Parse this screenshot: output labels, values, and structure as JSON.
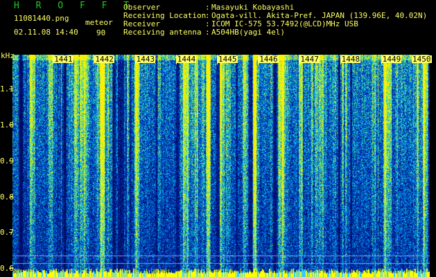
{
  "header": {
    "title": "H R O F F T",
    "file_name": "11081440.png",
    "date_time": "02.11.08 14:40",
    "mode_label": "meteor",
    "mode_value": "90",
    "fields": [
      {
        "key": "Observer",
        "value": "Masayuki Kobayashi"
      },
      {
        "key": "Receiving Location",
        "value": "Ogata-vill. Akita-Pref. JAPAN (139.96E, 40.02N)"
      },
      {
        "key": "Receiver",
        "value": "ICOM IC-575 53.7492(@LCD)MHz USB"
      },
      {
        "key": "Receiving antenna",
        "value": "A504HB(yagi 4el)"
      }
    ],
    "separator": ":"
  },
  "colors": {
    "background": "#000000",
    "text": "#ffff66",
    "title": "#22cc22",
    "spectrum_low": "#001a66",
    "spectrum_high": "#ffff00"
  },
  "chart_data": {
    "type": "heatmap",
    "ylabel": "kHz",
    "y_unit_label": "kHz",
    "ylim": [
      0.6,
      1.2
    ],
    "y_ticks": [
      "1.1",
      "1.0",
      "0.9",
      "0.8",
      "0.7",
      "0.6"
    ],
    "y_tick_values": [
      1.1,
      1.0,
      0.9,
      0.8,
      0.7,
      0.6
    ],
    "x_ticks": [
      "1441",
      "1442",
      "1443",
      "1444",
      "1445",
      "1446",
      "1447",
      "1448",
      "1449",
      "1450"
    ],
    "x_tick_values": [
      1441,
      1442,
      1443,
      1444,
      1445,
      1446,
      1447,
      1448,
      1449,
      1450
    ],
    "xlim": [
      1440,
      1450
    ]
  }
}
